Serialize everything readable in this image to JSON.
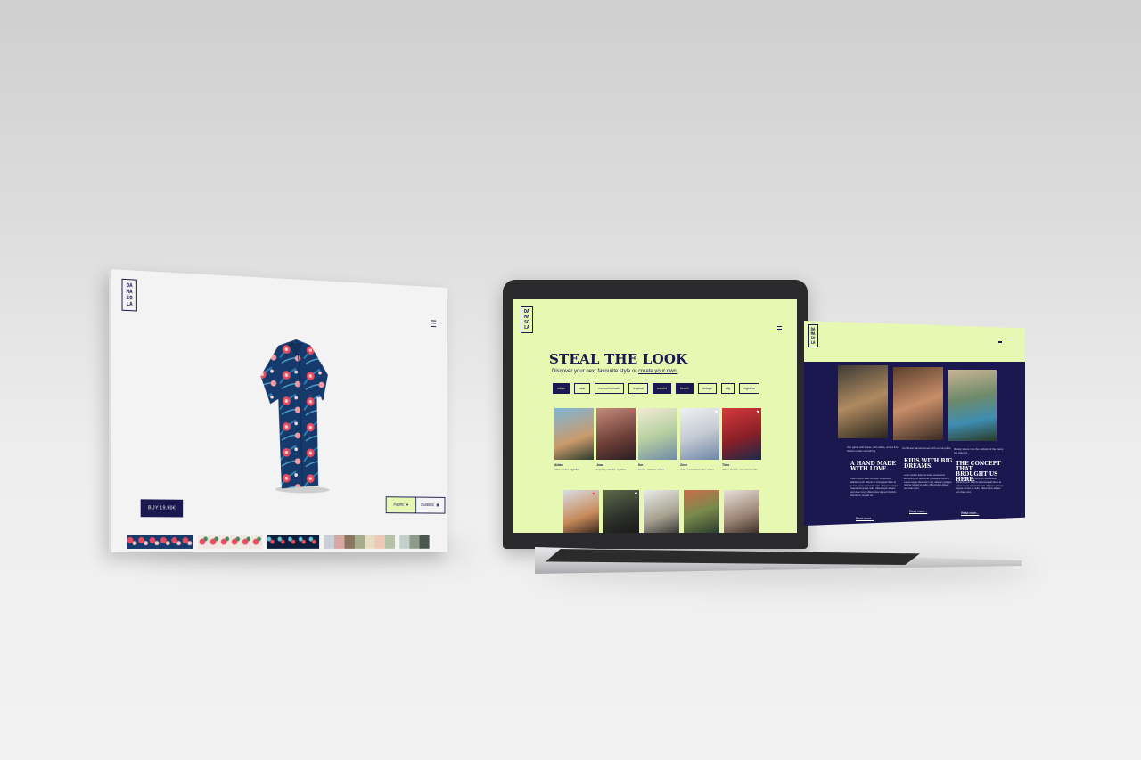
{
  "left_screen": {
    "logo_letters": [
      "DA",
      "MA",
      "SO",
      "LA"
    ],
    "buy_label": "BUY 19.90€",
    "toggle": {
      "fabric_label": "Fabric",
      "buttons_label": "Buttons"
    },
    "icons": [
      "menu-icon",
      "diamond-icon",
      "button-icon"
    ]
  },
  "laptop_screen": {
    "logo_letters": [
      "DA",
      "MA",
      "SO",
      "LA"
    ],
    "title": "STEAL THE LOOK",
    "subtitle_prefix": "Discover your next favourite style or ",
    "subtitle_link": "create your own.",
    "tags": [
      {
        "label": "urban",
        "active": true
      },
      {
        "label": "solar",
        "active": false
      },
      {
        "label": "monochromatic",
        "active": false
      },
      {
        "label": "tropical",
        "active": false
      },
      {
        "label": "colorful",
        "active": true
      },
      {
        "label": "beach",
        "active": true
      },
      {
        "label": "vintage",
        "active": false
      },
      {
        "label": "city",
        "active": false
      },
      {
        "label": "nightlive",
        "active": false
      }
    ],
    "cards": [
      {
        "name": "Aldan",
        "desc": "urban, solar, nightlive"
      },
      {
        "name": "Juan",
        "desc": "tropical, colorful, nightlive"
      },
      {
        "name": "Iko",
        "desc": "beach, colorful, urban"
      },
      {
        "name": "Zose",
        "desc": "solar, monochromatic, urban"
      },
      {
        "name": "Timo",
        "desc": "urban, beach, monochromatic"
      }
    ]
  },
  "right_screen": {
    "logo_letters": [
      "DA",
      "MA",
      "SO",
      "LA"
    ],
    "captions": [
      "Our pants with boots, still visible, and a fine fashion looks something",
      "Our finest hand-loomed with so complete",
      "Rarely where into the outlook of the many leg vision 2"
    ],
    "columns": [
      {
        "heading": "A HAND MADE WITH LOVE.",
        "body": "Lorem ipsum dolor sit amet, consectetur adipiscing elit. Mauris ac consequat libero at. Lacus neque elementum nisi. Aliquam quisque magna, tempor at nulla. Ullamcorper aliquet erat vitae nunc. Ullamcorper aliquet tincidunt lobortis mi, feugiat vel.",
        "link": "Read more..."
      },
      {
        "heading": "KIDS WITH BIG DREAMS.",
        "body": "Lorem ipsum dolor sit amet, consectetur adipiscing elit. Mauris ac consequat libero at. Lacus neque elementum nisi. Aliquam quisque magna, tempor at nulla. Ullamcorper aliquet erat vitae nunc.",
        "link": "Read more..."
      },
      {
        "heading": "THE CONCEPT THAT BROUGHT US HERE.",
        "body": "Lorem ipsum dolor sit amet, consectetur adipiscing elit. Mauris ac consequat libero at. Lacus neque elementum nisi. Aliquam quisque magna, tempor at nulla. Ullamcorper aliquet erat vitae nunc.",
        "link": "Read more..."
      }
    ]
  },
  "colors": {
    "navy": "#1b1850",
    "lime": "#e7f8b2",
    "accent_red": "#e84a5f"
  }
}
